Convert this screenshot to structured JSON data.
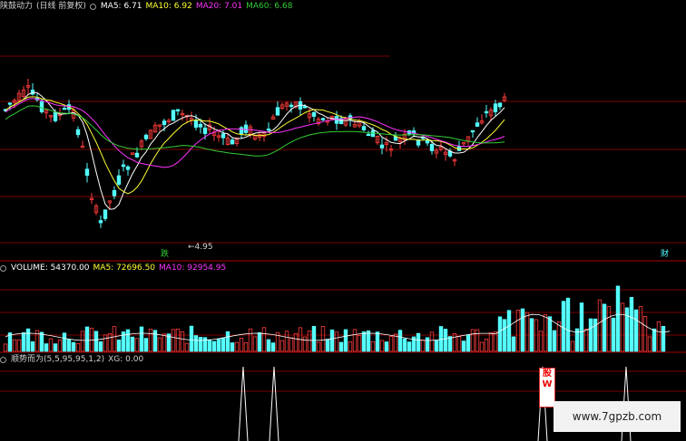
{
  "main_panel": {
    "indicator_name": "陕鼓动力",
    "period_label": "(日线 前复权)",
    "ma5_label": "MA5: 6.71",
    "ma10_label": "MA10: 6.92",
    "ma20_label": "MA20: 7.01",
    "ma60_label": "MA60: 6.68",
    "low_price_label": "4.95",
    "marker_left": "跌",
    "marker_right": "财"
  },
  "volume_panel": {
    "volume_label": "VOLUME: 54370.00",
    "ma5_label": "MA5: 72696.50",
    "ma10_label": "MA10: 92954.95"
  },
  "signal_panel": {
    "formula_label": "顺势而为(5,5,95,95,1,2)",
    "xg_label": "XG: 0.00",
    "peaks": [
      0,
      0,
      0,
      0,
      1,
      0,
      1,
      0,
      0,
      0,
      0,
      0,
      0,
      0,
      0,
      0,
      0,
      1,
      0,
      0,
      1
    ]
  },
  "watermark": {
    "site_text": "www.7gpzb.com"
  },
  "colors": {
    "up": "#ff3c3c",
    "down": "#54ffff",
    "ma5": "#ffffff",
    "ma10": "#ffff33",
    "ma20": "#ff33ff",
    "ma60": "#33cc33",
    "grid": "#7a0000",
    "separator": "#8a0000"
  }
}
